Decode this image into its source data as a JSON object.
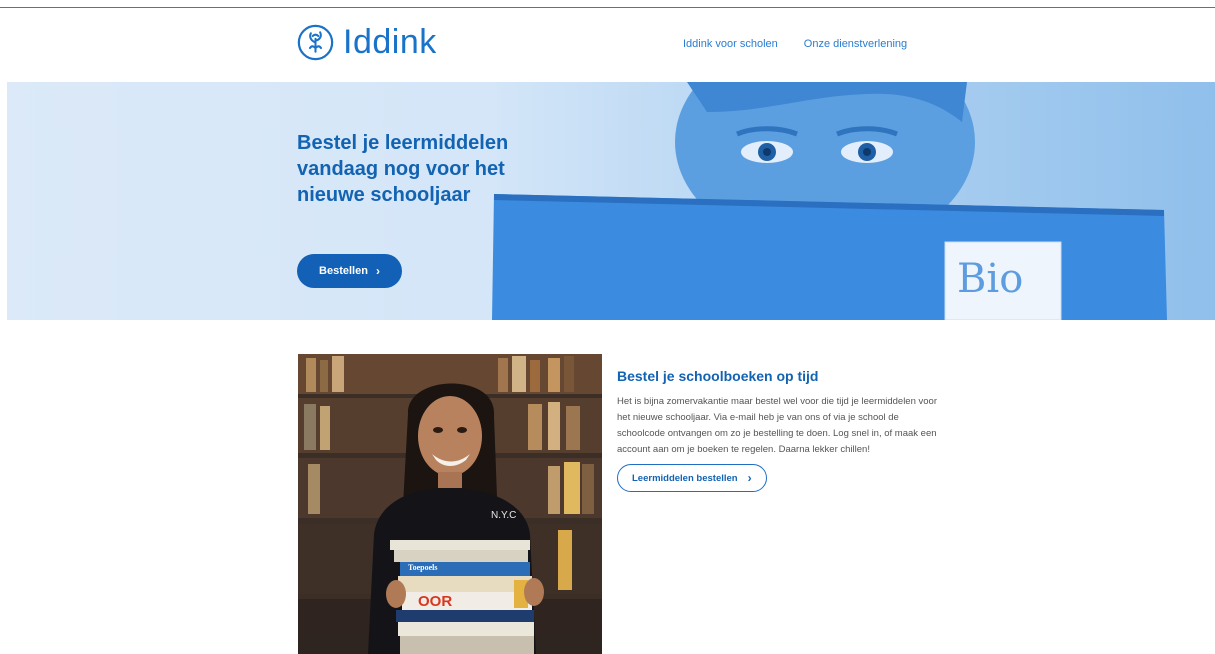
{
  "header": {
    "logo_text": "Iddink",
    "nav": [
      {
        "label": "Iddink voor scholen"
      },
      {
        "label": "Onze dienstverlening"
      }
    ]
  },
  "hero": {
    "title": "Bestel je leermiddelen vandaag nog voor het nieuwe schooljaar",
    "button_label": "Bestellen",
    "book_label": "Bio"
  },
  "photo_text": {
    "shirt": "N.Y.C",
    "book_top": "Toepoels",
    "book_red": "OOR"
  },
  "section": {
    "title": "Bestel je schoolboeken op tijd",
    "body": "Het is bijna zomervakantie maar bestel wel voor die tijd je leermiddelen voor het nieuwe schooljaar. Via e-mail heb je van ons of via je school de schoolcode ontvangen om zo je bestelling te doen. Log snel in, of maak een account aan om je boeken te regelen. Daarna lekker chillen!",
    "button_label": "Leermiddelen bestellen"
  },
  "colors": {
    "brand": "#1a73c9",
    "hero_title": "#1363b3",
    "button": "#1261b7"
  }
}
